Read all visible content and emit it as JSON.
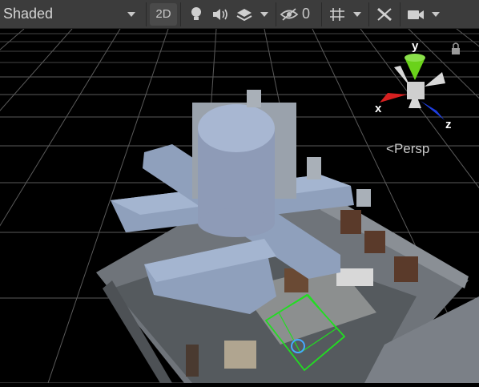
{
  "toolbar": {
    "shading_mode": "Shaded",
    "mode_2d": "2D",
    "hidden_count": "0",
    "icons": [
      "lighting-icon",
      "audio-icon",
      "effects-icon",
      "visibility-icon",
      "gizmo-grid-icon",
      "tools-icon",
      "camera-icon"
    ]
  },
  "gizmo": {
    "x_label": "x",
    "y_label": "y",
    "z_label": "z",
    "projection": "Persp",
    "colors": {
      "x": "#d62020",
      "y": "#6ad21a",
      "z": "#1e3ee0"
    }
  },
  "colors": {
    "toolbar_bg": "#3c3c3c",
    "viewport_bg": "#000000",
    "grid": "#5a5a5a",
    "selection": "#22dd22"
  }
}
